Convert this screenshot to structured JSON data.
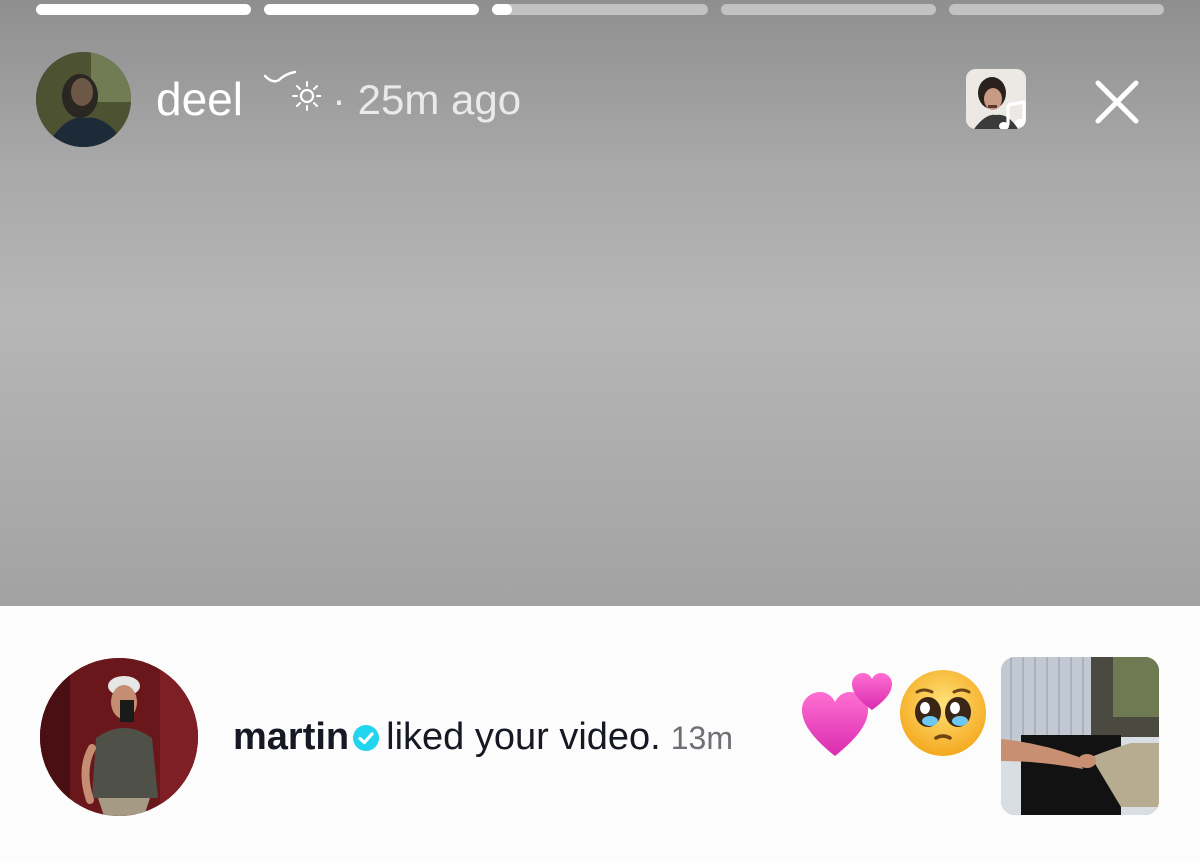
{
  "story": {
    "progress": [
      1.0,
      1.0,
      0.09,
      0.0,
      0.0
    ],
    "author": "deel",
    "time_text": "· 25m ago",
    "icons": {
      "decoration": "bird-sun-icon",
      "music": "music-note-icon",
      "close": "close-icon"
    }
  },
  "notification": {
    "username": "martin",
    "action_text": "liked your video.",
    "time": "13m",
    "emojis": [
      "two-hearts",
      "pleading-face"
    ]
  },
  "colors": {
    "story_background": "#a9a9a9",
    "progress_track": "rgba(255,255,255,0.45)",
    "progress_fill": "#ffffff",
    "verified_badge": "#20d5ec",
    "notification_bg": "#fdfcfd",
    "text_dark": "#161823",
    "text_muted": "#6f6f75"
  }
}
